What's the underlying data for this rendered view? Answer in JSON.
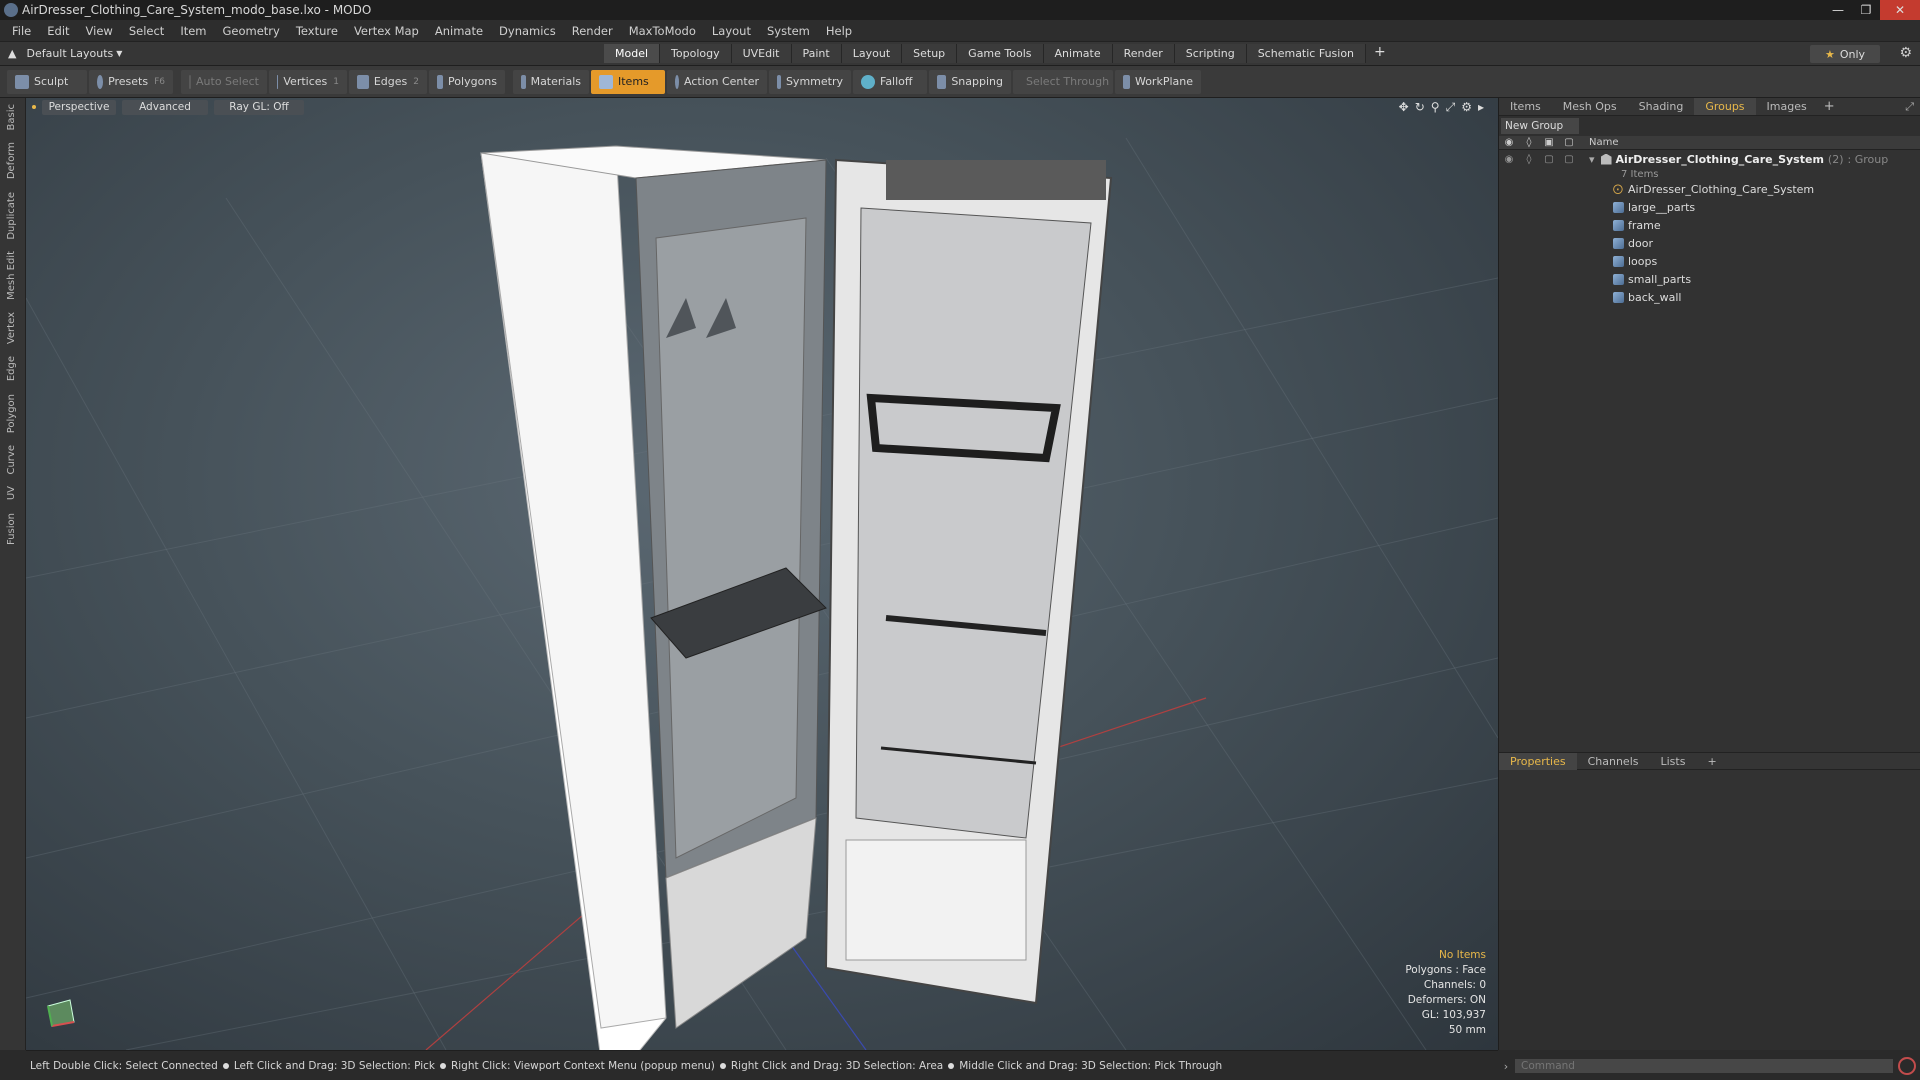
{
  "window": {
    "title": "AirDresser_Clothing_Care_System_modo_base.lxo - MODO"
  },
  "menu": [
    "File",
    "Edit",
    "View",
    "Select",
    "Item",
    "Geometry",
    "Texture",
    "Vertex Map",
    "Animate",
    "Dynamics",
    "Render",
    "MaxToModo",
    "Layout",
    "System",
    "Help"
  ],
  "layouts": {
    "label": "Default Layouts"
  },
  "layout_tabs": [
    {
      "label": "Model",
      "active": true
    },
    {
      "label": "Topology"
    },
    {
      "label": "UVEdit"
    },
    {
      "label": "Paint"
    },
    {
      "label": "Layout"
    },
    {
      "label": "Setup"
    },
    {
      "label": "Game Tools"
    },
    {
      "label": "Animate"
    },
    {
      "label": "Render"
    },
    {
      "label": "Scripting"
    },
    {
      "label": "Schematic Fusion"
    }
  ],
  "only_label": "Only",
  "toolbar": {
    "sculpt": "Sculpt",
    "presets": "Presets",
    "presets_key": "F6",
    "auto_select": "Auto Select",
    "vertices": "Vertices",
    "vertices_key": "1",
    "edges": "Edges",
    "edges_key": "2",
    "polygons": "Polygons",
    "materials": "Materials",
    "items": "Items",
    "action_center": "Action Center",
    "symmetry": "Symmetry",
    "falloff": "Falloff",
    "snapping": "Snapping",
    "select_through": "Select Through",
    "workplane": "WorkPlane"
  },
  "left_tabs": [
    "Basic",
    "Deform",
    "Duplicate",
    "Mesh Edit",
    "Vertex",
    "Edge",
    "Polygon",
    "Curve",
    "UV",
    "Fusion"
  ],
  "viewport": {
    "perspective": "Perspective",
    "advanced": "Advanced",
    "raygl": "Ray GL: Off"
  },
  "hud": {
    "no_items": "No Items",
    "polygons": "Polygons : Face",
    "channels": "Channels: 0",
    "deformers": "Deformers: ON",
    "gl": "GL: 103,937",
    "scale": "50 mm"
  },
  "right_tabs": [
    "Items",
    "Mesh Ops",
    "Shading",
    "Groups",
    "Images"
  ],
  "active_right_tab": "Groups",
  "new_group": "New Group",
  "list_header": {
    "name": "Name"
  },
  "group": {
    "name": "AirDresser_Clothing_Care_System",
    "count": "(2)",
    "type": ": Group",
    "items": "7 Items"
  },
  "children": [
    {
      "name": "AirDresser_Clothing_Care_System",
      "kind": "locator"
    },
    {
      "name": "large__parts",
      "kind": "mesh"
    },
    {
      "name": "frame",
      "kind": "mesh"
    },
    {
      "name": "door",
      "kind": "mesh"
    },
    {
      "name": "loops",
      "kind": "mesh"
    },
    {
      "name": "small_parts",
      "kind": "mesh"
    },
    {
      "name": "back_wall",
      "kind": "mesh"
    }
  ],
  "prop_tabs": [
    "Properties",
    "Channels",
    "Lists"
  ],
  "command_placeholder": "Command",
  "status": [
    "Left Double Click: Select Connected",
    "Left Click and Drag: 3D Selection: Pick",
    "Right Click: Viewport Context Menu (popup menu)",
    "Right Click and Drag: 3D Selection: Area",
    "Middle Click and Drag: 3D Selection: Pick Through"
  ],
  "colors": {
    "accent": "#e59a2a",
    "close": "#c43b2f"
  }
}
